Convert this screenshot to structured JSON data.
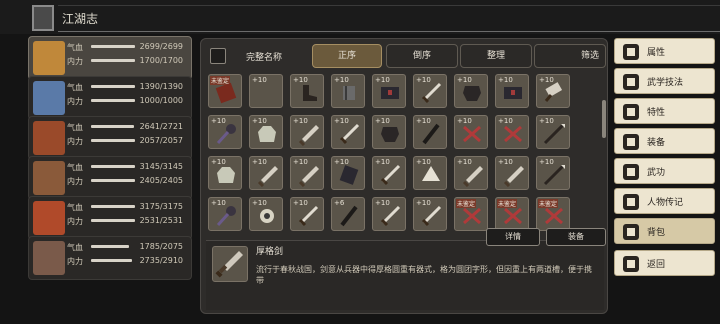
{
  "title": {
    "text": "江湖志"
  },
  "characters": [
    {
      "hp_label": "气血",
      "hp_value": "2699/2699",
      "mp_label": "内力",
      "mp_value": "1700/1700",
      "hp_ratio": 1.0,
      "mp_ratio": 1.0,
      "selected": true,
      "color": "#c0883a"
    },
    {
      "hp_label": "气血",
      "hp_value": "1390/1390",
      "mp_label": "内力",
      "mp_value": "1000/1000",
      "hp_ratio": 1.0,
      "mp_ratio": 1.0,
      "selected": false,
      "color": "#5a7aa8"
    },
    {
      "hp_label": "气血",
      "hp_value": "2641/2721",
      "mp_label": "内力",
      "mp_value": "2057/2057",
      "hp_ratio": 0.97,
      "mp_ratio": 1.0,
      "selected": false,
      "color": "#9a4a2a"
    },
    {
      "hp_label": "气血",
      "hp_value": "3145/3145",
      "mp_label": "内力",
      "mp_value": "2405/2405",
      "hp_ratio": 1.0,
      "mp_ratio": 1.0,
      "selected": false,
      "color": "#8a5a3a"
    },
    {
      "hp_label": "气血",
      "hp_value": "3175/3175",
      "mp_label": "内力",
      "mp_value": "2531/2531",
      "hp_ratio": 1.0,
      "mp_ratio": 1.0,
      "selected": false,
      "color": "#b04a2a"
    },
    {
      "hp_label": "气血",
      "hp_value": "1785/2075",
      "mp_label": "内力",
      "mp_value": "2735/2910",
      "hp_ratio": 0.86,
      "mp_ratio": 0.94,
      "selected": false,
      "color": "#7a5a4a"
    }
  ],
  "filters": {
    "full_name_label": "完整名称",
    "sort_asc": "正序",
    "sort_desc": "倒序",
    "organize": "整理",
    "filter": "筛选"
  },
  "inventory": [
    {
      "badge": "",
      "tag": "未鉴定",
      "icon": "book"
    },
    {
      "badge": "+10",
      "tag": "",
      "icon": "spike"
    },
    {
      "badge": "+10",
      "tag": "",
      "icon": "boot"
    },
    {
      "badge": "+10",
      "tag": "",
      "icon": "gauntlet"
    },
    {
      "badge": "+10",
      "tag": "",
      "icon": "chest"
    },
    {
      "badge": "+10",
      "tag": "",
      "icon": "sword"
    },
    {
      "badge": "+10",
      "tag": "",
      "icon": "armor"
    },
    {
      "badge": "+10",
      "tag": "",
      "icon": "chest"
    },
    {
      "badge": "+10",
      "tag": "",
      "icon": "cleaver"
    },
    {
      "badge": "+10",
      "tag": "",
      "icon": "mace"
    },
    {
      "badge": "+10",
      "tag": "",
      "icon": "robe"
    },
    {
      "badge": "+10",
      "tag": "",
      "icon": "dagger"
    },
    {
      "badge": "+10",
      "tag": "",
      "icon": "sword"
    },
    {
      "badge": "+10",
      "tag": "",
      "icon": "armor"
    },
    {
      "badge": "+10",
      "tag": "",
      "icon": "staff"
    },
    {
      "badge": "+10",
      "tag": "",
      "icon": "cross"
    },
    {
      "badge": "+10",
      "tag": "",
      "icon": "cross"
    },
    {
      "badge": "+10",
      "tag": "",
      "icon": "spear"
    },
    {
      "badge": "+10",
      "tag": "",
      "icon": "robe"
    },
    {
      "badge": "+10",
      "tag": "",
      "icon": "dagger"
    },
    {
      "badge": "+10",
      "tag": "",
      "icon": "dagger"
    },
    {
      "badge": "+10",
      "tag": "",
      "icon": "scroll"
    },
    {
      "badge": "+10",
      "tag": "",
      "icon": "sword"
    },
    {
      "badge": "+10",
      "tag": "",
      "icon": "fan"
    },
    {
      "badge": "+10",
      "tag": "",
      "icon": "dagger"
    },
    {
      "badge": "+10",
      "tag": "",
      "icon": "dagger"
    },
    {
      "badge": "+10",
      "tag": "",
      "icon": "spear"
    },
    {
      "badge": "+10",
      "tag": "",
      "icon": "mace"
    },
    {
      "badge": "+10",
      "tag": "",
      "icon": "ring"
    },
    {
      "badge": "+10",
      "tag": "",
      "icon": "sword"
    },
    {
      "badge": "+6",
      "tag": "",
      "icon": "staff"
    },
    {
      "badge": "+10",
      "tag": "",
      "icon": "sword"
    },
    {
      "badge": "+10",
      "tag": "",
      "icon": "sword"
    },
    {
      "badge": "",
      "tag": "未鉴定",
      "icon": "cross"
    },
    {
      "badge": "",
      "tag": "未鉴定",
      "icon": "cross"
    },
    {
      "badge": "",
      "tag": "未鉴定",
      "icon": "cross"
    }
  ],
  "detail": {
    "name": "厚格剑",
    "description": "流行于春秋战国，剑意从兵器中得厚格圆重有器式，格为圆团字形，但因重上有两道槽，便于携带",
    "details_button": "详情",
    "equip_button": "装备"
  },
  "menu": [
    {
      "label": "属性",
      "icon": "attribute-icon"
    },
    {
      "label": "武学技法",
      "icon": "skill-icon"
    },
    {
      "label": "特性",
      "icon": "trait-icon"
    },
    {
      "label": "装备",
      "icon": "equipment-icon"
    },
    {
      "label": "武功",
      "icon": "martial-icon"
    },
    {
      "label": "人物传记",
      "icon": "biography-icon"
    },
    {
      "label": "背包",
      "icon": "bag-icon"
    },
    {
      "label": "返回",
      "icon": "back-icon"
    }
  ],
  "colors": {
    "accent": "#a58e62",
    "cell": "#5a5449",
    "menu_bg": "#ede5d0",
    "menu_selected": "#d6c9a6"
  }
}
